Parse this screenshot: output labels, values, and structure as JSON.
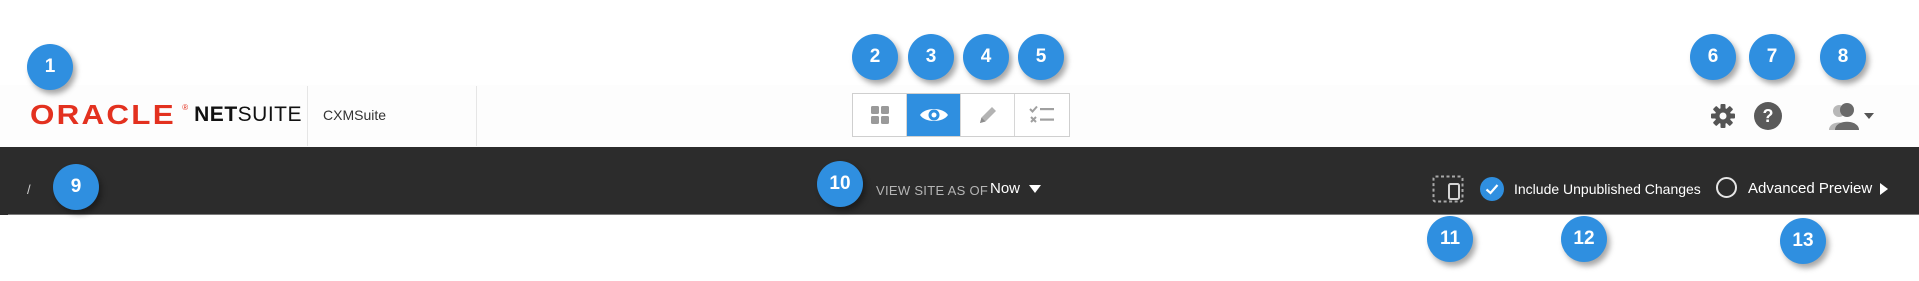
{
  "header": {
    "logo": {
      "oracle": "ORACLE",
      "mark": "®",
      "netsuite_bold": "NET",
      "netsuite_rest": "SUITE"
    },
    "company": "CXMSuite",
    "modes": [
      {
        "name": "grid",
        "icon": "grid-icon",
        "active": false
      },
      {
        "name": "view",
        "icon": "eye-icon",
        "active": true
      },
      {
        "name": "edit",
        "icon": "pencil-icon",
        "active": false
      },
      {
        "name": "checklist",
        "icon": "checklist-icon",
        "active": false
      }
    ],
    "help_glyph": "?",
    "accent": "#2f8fe0"
  },
  "toolbar": {
    "breadcrumb": "/",
    "view_site_label": "VIEW SITE AS OF",
    "view_site_value": "Now",
    "include_unpublished_label": "Include Unpublished Changes",
    "include_unpublished_checked": true,
    "advanced_preview_label": "Advanced Preview",
    "advanced_preview_selected": false
  },
  "callouts": [
    "1",
    "2",
    "3",
    "4",
    "5",
    "6",
    "7",
    "8",
    "9",
    "10",
    "11",
    "12",
    "13"
  ]
}
